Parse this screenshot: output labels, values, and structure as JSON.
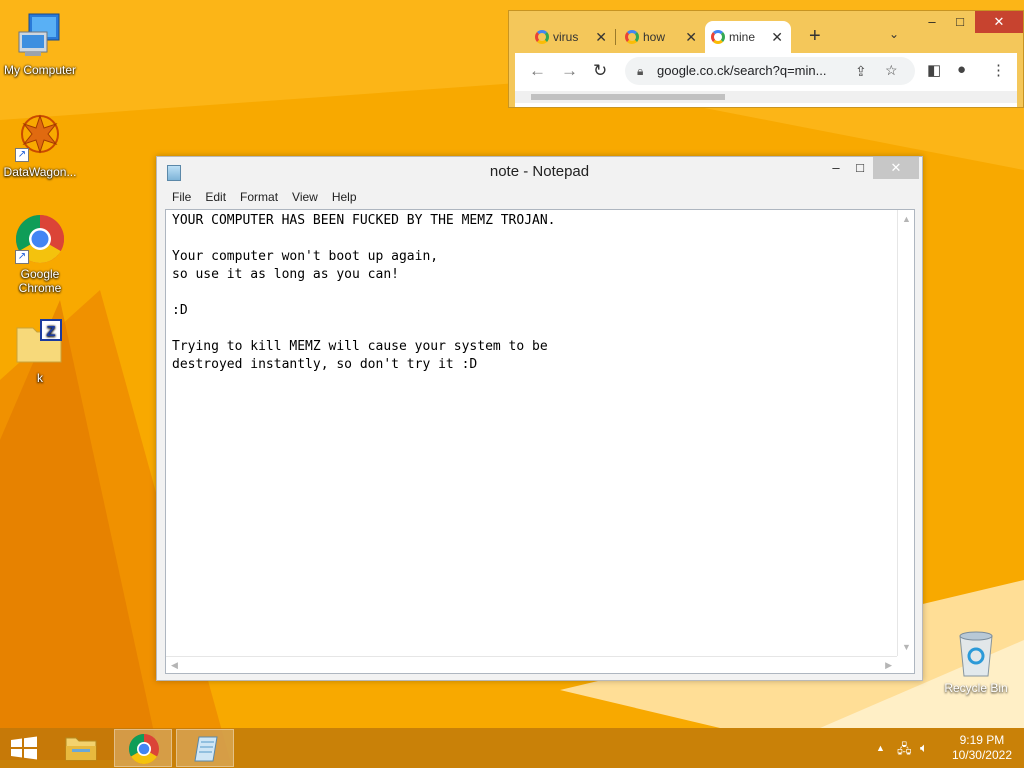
{
  "desktop": {
    "icons": [
      {
        "label": "My Computer"
      },
      {
        "label": "DataWagon..."
      },
      {
        "label": "Google Chrome"
      },
      {
        "label": "k"
      }
    ],
    "recycle_bin": "Recycle Bin"
  },
  "chrome": {
    "tabs": [
      {
        "label": "virus"
      },
      {
        "label": "how"
      },
      {
        "label": "mine"
      }
    ],
    "url": "google.co.ck/search?q=min...",
    "window_controls": {
      "minimize": "–",
      "maximize": "□",
      "close": "✕"
    }
  },
  "notepad": {
    "title": "note - Notepad",
    "menu": [
      "File",
      "Edit",
      "Format",
      "View",
      "Help"
    ],
    "content": "YOUR COMPUTER HAS BEEN FUCKED BY THE MEMZ TROJAN.\n\nYour computer won't boot up again,\nso use it as long as you can!\n\n:D\n\nTrying to kill MEMZ will cause your system to be\ndestroyed instantly, so don't try it :D"
  },
  "taskbar": {
    "time": "9:19 PM",
    "date": "10/30/2022"
  },
  "colors": {
    "wallpaper": "#f7a800",
    "wallpaper_light": "#ffc83a",
    "taskbar": "#be780a"
  }
}
